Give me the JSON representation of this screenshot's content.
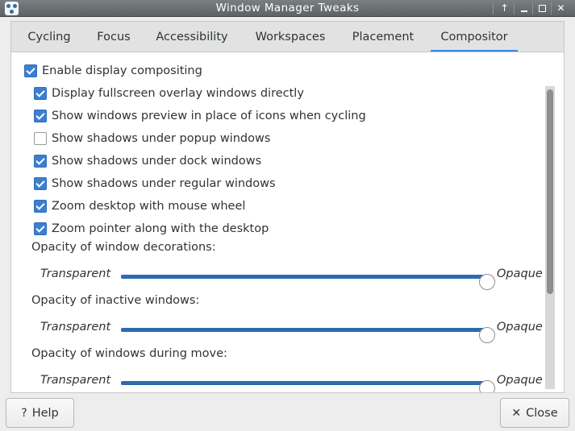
{
  "window": {
    "title": "Window Manager Tweaks",
    "buttons": {
      "up": "↑",
      "minimize": "□",
      "maximize": "□",
      "close": "✕"
    }
  },
  "tabs": [
    {
      "label": "Cycling",
      "active": false
    },
    {
      "label": "Focus",
      "active": false
    },
    {
      "label": "Accessibility",
      "active": false
    },
    {
      "label": "Workspaces",
      "active": false
    },
    {
      "label": "Placement",
      "active": false
    },
    {
      "label": "Compositor",
      "active": true
    }
  ],
  "compositor": {
    "enable": {
      "label": "Enable display compositing",
      "checked": true
    },
    "options": [
      {
        "label": "Display fullscreen overlay windows directly",
        "checked": true
      },
      {
        "label": "Show windows preview in place of icons when cycling",
        "checked": true
      },
      {
        "label": "Show shadows under popup windows",
        "checked": false
      },
      {
        "label": "Show shadows under dock windows",
        "checked": true
      },
      {
        "label": "Show shadows under regular windows",
        "checked": true
      },
      {
        "label": "Zoom desktop with mouse wheel",
        "checked": true
      },
      {
        "label": "Zoom pointer along with the desktop",
        "checked": true
      }
    ],
    "opacity": [
      {
        "label": "Opacity of window decorations:",
        "min_label": "Transparent",
        "max_label": "Opaque",
        "value": 1.0
      },
      {
        "label": "Opacity of inactive windows:",
        "min_label": "Transparent",
        "max_label": "Opaque",
        "value": 1.0
      },
      {
        "label": "Opacity of windows during move:",
        "min_label": "Transparent",
        "max_label": "Opaque",
        "value": 1.0
      }
    ]
  },
  "footer": {
    "help_icon": "?",
    "help_label": "Help",
    "close_icon": "✕",
    "close_label": "Close"
  },
  "colors": {
    "accent": "#3584e4",
    "checkbox": "#3b7fd1",
    "slider_fill": "#2d6bb0"
  }
}
